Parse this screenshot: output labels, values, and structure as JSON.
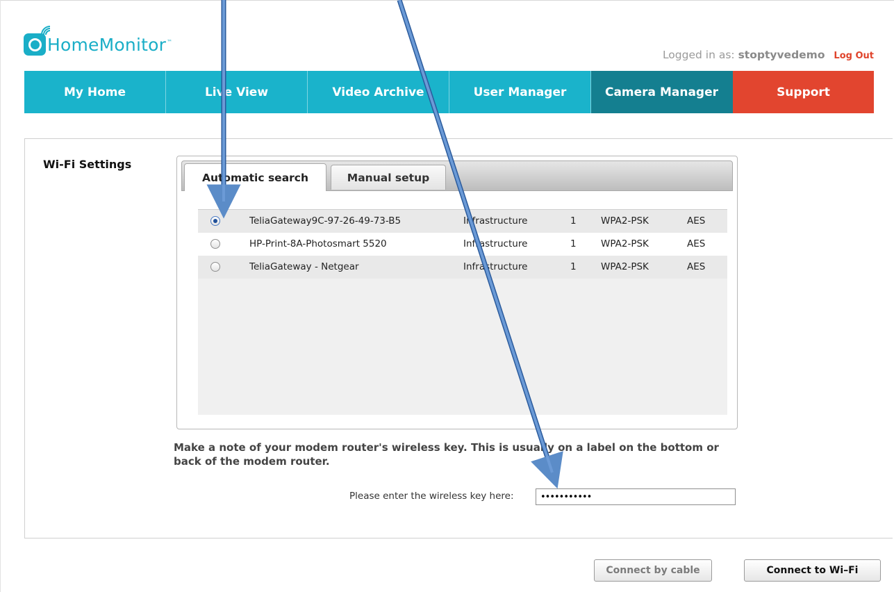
{
  "header": {
    "logo_text": "HomeMonitor",
    "logo_tm": "™",
    "login_prefix": "Logged in as:",
    "username": "stoptyvedemo",
    "logout_label": "Log Out"
  },
  "nav": {
    "items": [
      {
        "label": "My Home"
      },
      {
        "label": "Live View"
      },
      {
        "label": "Video Archive"
      },
      {
        "label": "User Manager"
      },
      {
        "label": "Camera Manager"
      },
      {
        "label": "Support"
      }
    ],
    "active": "Camera Manager"
  },
  "wifi": {
    "section_title": "Wi-Fi Settings",
    "tabs": [
      {
        "label": "Automatic search"
      },
      {
        "label": "Manual setup"
      }
    ],
    "active_tab": "Automatic search",
    "networks": [
      {
        "ssid": "TeliaGateway9C-97-26-49-73-B5",
        "mode": "Infrastructure",
        "channel": "1",
        "security": "WPA2-PSK",
        "cipher": "AES",
        "selected": true
      },
      {
        "ssid": "HP-Print-8A-Photosmart 5520",
        "mode": "Infrastructure",
        "channel": "1",
        "security": "WPA2-PSK",
        "cipher": "AES",
        "selected": false
      },
      {
        "ssid": "TeliaGateway - Netgear",
        "mode": "Infrastructure",
        "channel": "1",
        "security": "WPA2-PSK",
        "cipher": "AES",
        "selected": false
      }
    ],
    "note": "Make a note of your modem router's wireless key. This is usually on a label on the bottom or back of the modem router.",
    "key_label": "Please enter the wireless key here:",
    "key_value": "•••••••••••"
  },
  "actions": {
    "connect_cable_label": "Connect by cable",
    "connect_wifi_label": "Connect to Wi–Fi"
  },
  "colors": {
    "brand": "#1aaec7",
    "nav_active": "#147f90",
    "support": "#e2452f",
    "annotation_arrow": "#5b8cc8"
  },
  "icons": [
    "wifi-logo-icon",
    "radio-checked-icon",
    "radio-unchecked-icon",
    "annotation-arrow-icon"
  ]
}
